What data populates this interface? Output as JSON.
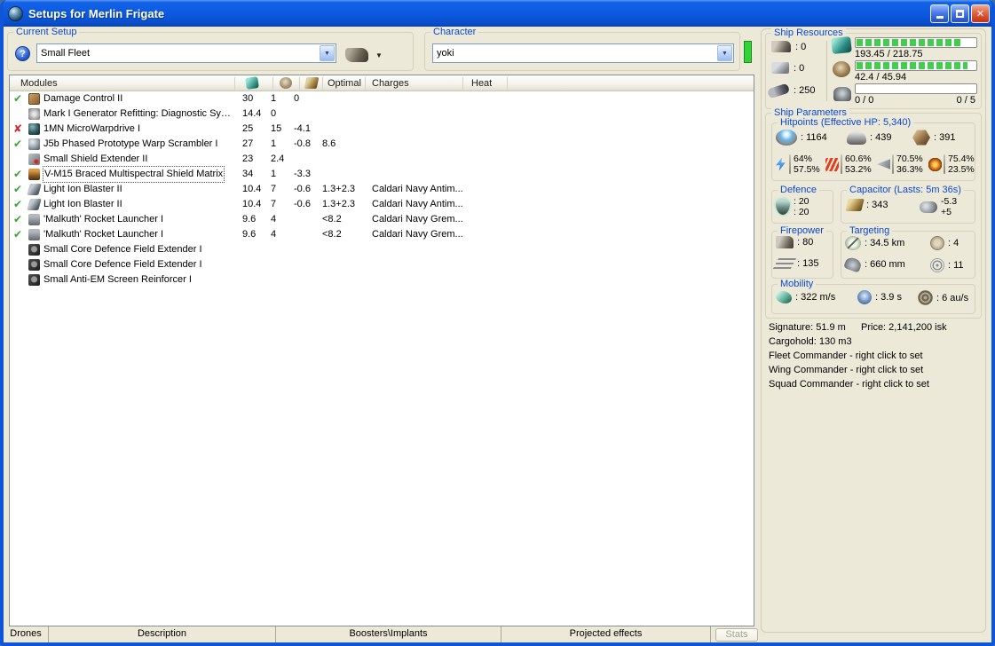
{
  "window": {
    "title": "Setups for Merlin Frigate"
  },
  "setup": {
    "label": "Current Setup",
    "value": "Small Fleet"
  },
  "character": {
    "label": "Character",
    "value": "yoki"
  },
  "table": {
    "header": {
      "modules": "Modules",
      "optimal": "Optimal",
      "charges": "Charges",
      "heat": "Heat"
    },
    "status_glyphs": {
      "ok": "✔",
      "error": "✘"
    },
    "rows": [
      {
        "status": "ok",
        "icon": "damage-control",
        "name": "Damage Control II",
        "cpu": "30",
        "pg": "1",
        "cap": "0",
        "optimal": "",
        "charges": ""
      },
      {
        "status": "",
        "icon": "generator-refitting",
        "name": "Mark I Generator Refitting: Diagnostic Syst...",
        "cpu": "14.4",
        "pg": "0",
        "cap": "",
        "optimal": "",
        "charges": ""
      },
      {
        "status": "error",
        "icon": "microwarpdrive",
        "name": "1MN MicroWarpdrive I",
        "cpu": "25",
        "pg": "15",
        "cap": "-4.1",
        "optimal": "",
        "charges": ""
      },
      {
        "status": "ok",
        "icon": "warp-scrambler",
        "name": "J5b Phased Prototype Warp Scrambler I",
        "cpu": "27",
        "pg": "1",
        "cap": "-0.8",
        "optimal": "8.6",
        "charges": ""
      },
      {
        "status": "",
        "icon": "shield-extender",
        "name": "Small Shield Extender II",
        "cpu": "23",
        "pg": "2.4",
        "cap": "",
        "optimal": "",
        "charges": ""
      },
      {
        "status": "ok",
        "icon": "shield-hardener",
        "name": "V-M15 Braced Multispectral Shield Matrix",
        "cpu": "34",
        "pg": "1",
        "cap": "-3.3",
        "optimal": "",
        "charges": "",
        "selected": true
      },
      {
        "status": "ok",
        "icon": "blaster",
        "name": "Light Ion Blaster II",
        "cpu": "10.4",
        "pg": "7",
        "cap": "-0.6",
        "optimal": "1.3+2.3",
        "charges": "Caldari Navy Antim..."
      },
      {
        "status": "ok",
        "icon": "blaster",
        "name": "Light Ion Blaster II",
        "cpu": "10.4",
        "pg": "7",
        "cap": "-0.6",
        "optimal": "1.3+2.3",
        "charges": "Caldari Navy Antim..."
      },
      {
        "status": "ok",
        "icon": "rocket-launcher",
        "name": "'Malkuth' Rocket Launcher I",
        "cpu": "9.6",
        "pg": "4",
        "cap": "",
        "optimal": "<8.2",
        "charges": "Caldari Navy Grem..."
      },
      {
        "status": "ok",
        "icon": "rocket-launcher",
        "name": "'Malkuth' Rocket Launcher I",
        "cpu": "9.6",
        "pg": "4",
        "cap": "",
        "optimal": "<8.2",
        "charges": "Caldari Navy Grem..."
      },
      {
        "status": "",
        "icon": "rig",
        "name": "Small Core Defence Field Extender I",
        "cpu": "",
        "pg": "",
        "cap": "",
        "optimal": "",
        "charges": ""
      },
      {
        "status": "",
        "icon": "rig",
        "name": "Small Core Defence Field Extender I",
        "cpu": "",
        "pg": "",
        "cap": "",
        "optimal": "",
        "charges": ""
      },
      {
        "status": "",
        "icon": "rig",
        "name": "Small Anti-EM Screen Reinforcer I",
        "cpu": "",
        "pg": "",
        "cap": "",
        "optimal": "",
        "charges": ""
      }
    ]
  },
  "resources": {
    "label": "Ship Resources",
    "turrets": ": 0",
    "launchers": ": 0",
    "calibration": ": 250",
    "cpu": {
      "text": "193.45 / 218.75",
      "pct": 88
    },
    "powergrid": {
      "text": "42.4 / 45.94",
      "pct": 92
    },
    "drones": {
      "bay_text": "0 / 0",
      "bandwidth_text": "0 / 5",
      "pct": 0
    }
  },
  "parameters": {
    "label": "Ship Parameters",
    "hitpoints": {
      "label": "Hitpoints (Effective HP: 5,340)",
      "shield": ": 1164",
      "armor": ": 439",
      "structure": ": 391",
      "resists": {
        "em": {
          "shield": "64%",
          "armor": "57.5%"
        },
        "thermal": {
          "shield": "60.6%",
          "armor": "53.2%"
        },
        "kinetic": {
          "shield": "70.5%",
          "armor": "36.3%"
        },
        "explosive": {
          "shield": "75.4%",
          "armor": "23.5%"
        }
      }
    },
    "defence": {
      "label": "Defence",
      "value1": ": 20",
      "value2": ": 20"
    },
    "capacitor": {
      "label": "Capacitor (Lasts: 5m 36s)",
      "amount": ": 343",
      "delta_minus": "-5.3",
      "delta_plus": "+5"
    },
    "firepower": {
      "label": "Firepower",
      "turret": ": 80",
      "missile": ": 135"
    },
    "targeting": {
      "label": "Targeting",
      "range": ": 34.5 km",
      "max_targets": ": 4",
      "scan_res": ": 660 mm",
      "sensor_strength": ": 11"
    },
    "mobility": {
      "label": "Mobility",
      "speed": ": 322 m/s",
      "align": ": 3.9 s",
      "warp": ": 6 au/s"
    }
  },
  "info": {
    "signature": "Signature: 51.9 m",
    "price": "Price: 2,141,200 isk",
    "cargohold": "Cargohold: 130 m3",
    "fleet": "Fleet Commander - right click to set",
    "wing": "Wing Commander - right click to set",
    "squad": "Squad Commander - right click to set"
  },
  "bottom": {
    "tabs": [
      "Drones",
      "Description",
      "Boosters\\Implants",
      "Projected effects"
    ],
    "stats": "Stats"
  }
}
